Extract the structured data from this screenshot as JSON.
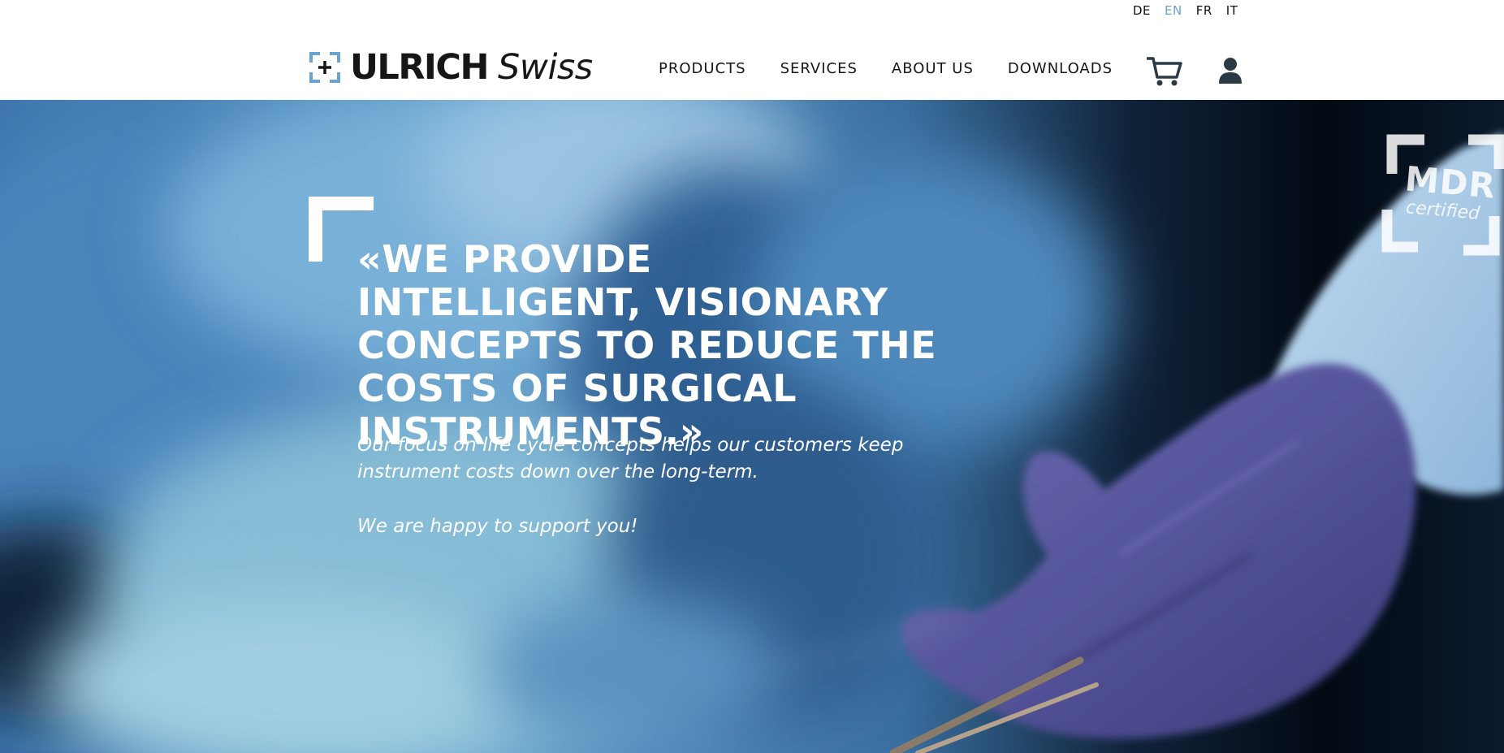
{
  "languages": [
    {
      "code": "DE",
      "active": false
    },
    {
      "code": "EN",
      "active": true
    },
    {
      "code": "FR",
      "active": false
    },
    {
      "code": "IT",
      "active": false
    }
  ],
  "brand": {
    "name_bold": "ULRICH",
    "name_light": "Swiss",
    "accent_color": "#6ba3cf"
  },
  "nav": {
    "items": [
      "PRODUCTS",
      "SERVICES",
      "ABOUT US",
      "DOWNLOADS"
    ]
  },
  "icons": {
    "cart": "shopping-cart-icon",
    "user": "user-account-icon"
  },
  "hero": {
    "headline": "«WE PROVIDE INTELLIGENT, VISIONARY CONCEPTS TO REDUCE THE COSTS OF SURGICAL INSTRUMENTS.»",
    "lead": "Our focus on life cycle concepts helps our customers keep instrument costs down over the long-term.",
    "tagline": "We are happy to support you!",
    "badge": {
      "title": "MDR",
      "subtitle": "certified"
    }
  }
}
